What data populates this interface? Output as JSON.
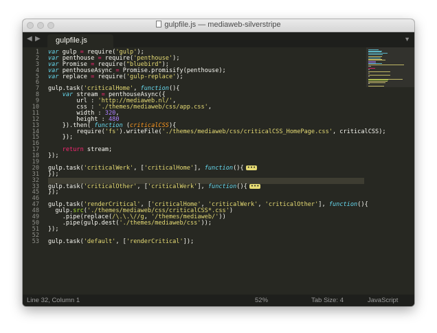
{
  "window": {
    "title": "gulpfile.js — mediaweb-silverstripe"
  },
  "tabs": [
    {
      "label": "gulpfile.js"
    }
  ],
  "tabbar": {
    "nav_back": "◀",
    "nav_forward": "▶",
    "menu": "▼"
  },
  "editor": {
    "line_numbers": [
      "1",
      "2",
      "3",
      "4",
      "5",
      "6",
      "7",
      "8",
      "9",
      "10",
      "11",
      "12",
      "13",
      "14",
      "15",
      "16",
      "17",
      "18",
      "19",
      "20",
      "31",
      "32",
      "33",
      "45",
      "46",
      "47",
      "48",
      "49",
      "50",
      "51",
      "52",
      "53"
    ],
    "lines": [
      [
        {
          "t": "var",
          "c": "k"
        },
        {
          "t": " gulp "
        },
        {
          "t": "=",
          "c": "kw"
        },
        {
          "t": " require("
        },
        {
          "t": "'gulp'",
          "c": "s"
        },
        {
          "t": ");"
        }
      ],
      [
        {
          "t": "var",
          "c": "k"
        },
        {
          "t": " penthouse "
        },
        {
          "t": "=",
          "c": "kw"
        },
        {
          "t": " require("
        },
        {
          "t": "'penthouse'",
          "c": "s"
        },
        {
          "t": ");"
        }
      ],
      [
        {
          "t": "var",
          "c": "k"
        },
        {
          "t": " Promise "
        },
        {
          "t": "=",
          "c": "kw"
        },
        {
          "t": " require("
        },
        {
          "t": "\"bluebird\"",
          "c": "s"
        },
        {
          "t": ");"
        }
      ],
      [
        {
          "t": "var",
          "c": "k"
        },
        {
          "t": " penthouseAsync "
        },
        {
          "t": "=",
          "c": "kw"
        },
        {
          "t": " Promise.promisify(penthouse);"
        }
      ],
      [
        {
          "t": "var",
          "c": "k"
        },
        {
          "t": " replace "
        },
        {
          "t": "=",
          "c": "kw"
        },
        {
          "t": " require("
        },
        {
          "t": "'gulp-replace'",
          "c": "s"
        },
        {
          "t": ");"
        }
      ],
      [],
      [
        {
          "t": "gulp.task("
        },
        {
          "t": "'criticalHome'",
          "c": "s"
        },
        {
          "t": ", "
        },
        {
          "t": "function",
          "c": "k"
        },
        {
          "t": "(){"
        }
      ],
      [
        {
          "t": "    "
        },
        {
          "t": "var",
          "c": "k"
        },
        {
          "t": " stream "
        },
        {
          "t": "=",
          "c": "kw"
        },
        {
          "t": " penthouseAsync({"
        }
      ],
      [
        {
          "t": "        url : "
        },
        {
          "t": "'http://mediaweb.nl/'",
          "c": "s"
        },
        {
          "t": ","
        }
      ],
      [
        {
          "t": "        css : "
        },
        {
          "t": "'./themes/mediaweb/css/app.css'",
          "c": "s"
        },
        {
          "t": ","
        }
      ],
      [
        {
          "t": "        width : "
        },
        {
          "t": "320",
          "c": "n"
        },
        {
          "t": ","
        }
      ],
      [
        {
          "t": "        height : "
        },
        {
          "t": "480",
          "c": "n"
        }
      ],
      [
        {
          "t": "    }).then( "
        },
        {
          "t": "function",
          "c": "k"
        },
        {
          "t": " ("
        },
        {
          "t": "criticalCSS",
          "c": "p"
        },
        {
          "t": "){"
        }
      ],
      [
        {
          "t": "        require("
        },
        {
          "t": "'fs'",
          "c": "s"
        },
        {
          "t": ").writeFile("
        },
        {
          "t": "'./themes/mediaweb/css/criticalCSS_HomePage.css'",
          "c": "s"
        },
        {
          "t": ", criticalCSS);"
        }
      ],
      [
        {
          "t": "    });"
        }
      ],
      [],
      [
        {
          "t": "    "
        },
        {
          "t": "return",
          "c": "kw"
        },
        {
          "t": " stream;"
        }
      ],
      [
        {
          "t": "});"
        }
      ],
      [],
      [
        {
          "t": "gulp.task("
        },
        {
          "t": "'criticalWerk'",
          "c": "s"
        },
        {
          "t": ", ["
        },
        {
          "t": "'criticalHome'",
          "c": "s"
        },
        {
          "t": "], "
        },
        {
          "t": "function",
          "c": "k"
        },
        {
          "t": "(){"
        },
        {
          "t": "•••",
          "c": "fold"
        }
      ],
      [
        {
          "t": "});"
        }
      ],
      [],
      [
        {
          "t": "gulp.task("
        },
        {
          "t": "'criticalOther'",
          "c": "s"
        },
        {
          "t": ", ["
        },
        {
          "t": "'criticalWerk'",
          "c": "s"
        },
        {
          "t": "], "
        },
        {
          "t": "function",
          "c": "k"
        },
        {
          "t": "(){"
        },
        {
          "t": "•••",
          "c": "fold"
        }
      ],
      [
        {
          "t": "});"
        }
      ],
      [],
      [
        {
          "t": "gulp.task("
        },
        {
          "t": "'renderCritical'",
          "c": "s"
        },
        {
          "t": ", ["
        },
        {
          "t": "'criticalHome'",
          "c": "s"
        },
        {
          "t": ", "
        },
        {
          "t": "'criticalWerk'",
          "c": "s"
        },
        {
          "t": ", "
        },
        {
          "t": "'criticalOther'",
          "c": "s"
        },
        {
          "t": "], "
        },
        {
          "t": "function",
          "c": "k"
        },
        {
          "t": "(){"
        }
      ],
      [
        {
          "t": "  gulp."
        },
        {
          "t": "src",
          "c": "fn"
        },
        {
          "t": "("
        },
        {
          "t": "'./themes/mediaweb/css/criticalCSS*.css'",
          "c": "s"
        },
        {
          "t": ")"
        }
      ],
      [
        {
          "t": "    .pipe(replace("
        },
        {
          "t": "/\\.\\.\\//g",
          "c": "s"
        },
        {
          "t": ", "
        },
        {
          "t": "'/themes/mediaweb/'",
          "c": "s"
        },
        {
          "t": "))"
        }
      ],
      [
        {
          "t": "    .pipe(gulp.dest("
        },
        {
          "t": "'./themes/mediaweb/css'",
          "c": "s"
        },
        {
          "t": "));"
        }
      ],
      [
        {
          "t": "});"
        }
      ],
      [],
      [
        {
          "t": "gulp.task("
        },
        {
          "t": "'default'",
          "c": "s"
        },
        {
          "t": ", ["
        },
        {
          "t": "'renderCritical'",
          "c": "s"
        },
        {
          "t": "]);"
        }
      ]
    ],
    "current_line_index": 21
  },
  "statusbar": {
    "position": "Line 32, Column 1",
    "zoom": "52%",
    "tab_size": "Tab Size: 4",
    "syntax": "JavaScript"
  }
}
